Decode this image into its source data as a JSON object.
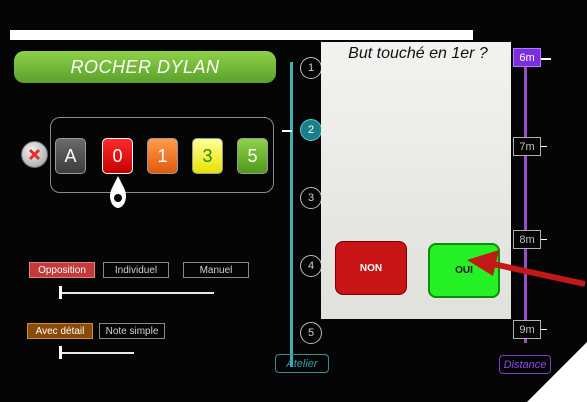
{
  "player": {
    "name": "ROCHER  DYLAN"
  },
  "scores": {
    "A": "A",
    "zero": "0",
    "one": "1",
    "three": "3",
    "five": "5",
    "selected": "0"
  },
  "mode_options": {
    "opposition": "Opposition",
    "individuel": "Individuel",
    "manuel": "Manuel",
    "selected": "Opposition"
  },
  "detail_options": {
    "avec_detail": "Avec détail",
    "note_simple": "Note simple",
    "selected": "Avec détail"
  },
  "atelier": {
    "label": "Atelier",
    "steps": [
      "1",
      "2",
      "3",
      "4",
      "5"
    ],
    "current": "2"
  },
  "dialog": {
    "question": "But  touché en 1er  ?",
    "no_label": "NON",
    "yes_label": "OUI"
  },
  "distance": {
    "label": "Distance",
    "marks": [
      "6m",
      "7m",
      "8m",
      "9m"
    ],
    "current": "6m"
  },
  "colors": {
    "accent_teal": "#1a7f8a",
    "accent_purple": "#7a2ee0",
    "banner_green": "#6ab834",
    "yes_green": "#25f125",
    "no_red": "#c81414"
  }
}
